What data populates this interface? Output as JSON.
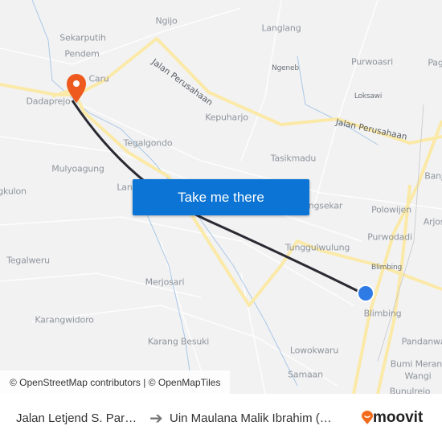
{
  "map": {
    "labels": [
      "Ngijo",
      "Langlang",
      "Sekarputih",
      "Pendem",
      "Purwoasri",
      "Pag",
      "Ngeneb",
      "Caru",
      "Dadaprejo",
      "Loksawi",
      "Kepuharjo",
      "Tegalgondo",
      "Tasikmadu",
      "Banj",
      "Mulyoagung",
      "Lan",
      "gkulon",
      "ngsekar",
      "Polowijen",
      "Arjos",
      "Purwodadi",
      "Tunggulwulung",
      "Blimbing",
      "Tegalweru",
      "Merjosari",
      "Blimbing",
      "Karangwidoro",
      "Pandanwa",
      "Karang Besuki",
      "Lowokwaru",
      "Bumi Merant",
      "Wangi",
      "Samaan",
      "Bunulrejo"
    ],
    "roads": [
      "Jalan Perusahaan",
      "Jalan Perusahaan"
    ],
    "route_color": "#2a2a33",
    "origin_color": "#2f7be6",
    "destination_color": "#ee5a1d",
    "cta": "Take me there",
    "attribution": "© OpenStreetMap contributors | © OpenMapTiles"
  },
  "footer": {
    "from": "Jalan Letjend S. Par…",
    "arrow_icon": "arrow-right-icon",
    "to": "Uin Maulana Malik Ibrahim (…",
    "brand": "moovit",
    "brand_color": "#f26b1d"
  }
}
